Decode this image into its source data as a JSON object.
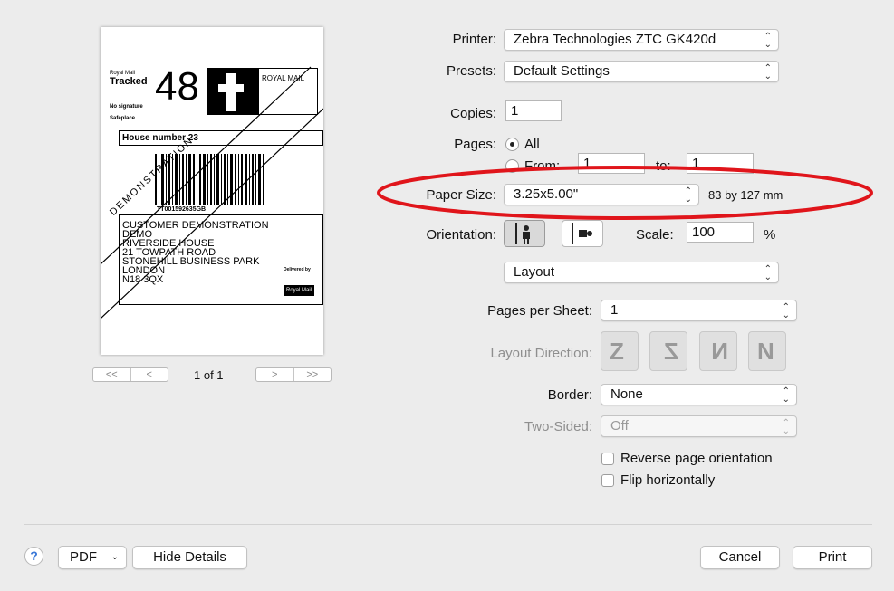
{
  "printer": {
    "label": "Printer:",
    "value": "Zebra Technologies ZTC GK420d"
  },
  "presets": {
    "label": "Presets:",
    "value": "Default Settings"
  },
  "copies": {
    "label": "Copies:",
    "value": "1"
  },
  "pages": {
    "label": "Pages:",
    "all_label": "All",
    "from_label": "From:",
    "from_value": "1",
    "to_label": "to:",
    "to_value": "1"
  },
  "paper_size": {
    "label": "Paper Size:",
    "value": "3.25x5.00\"",
    "dimensions": "83 by 127 mm"
  },
  "orientation": {
    "label": "Orientation:",
    "selected": "portrait"
  },
  "scale": {
    "label": "Scale:",
    "value": "100",
    "unit": "%"
  },
  "section": {
    "value": "Layout"
  },
  "layout": {
    "pages_per_sheet_label": "Pages per Sheet:",
    "pages_per_sheet_value": "1",
    "direction_label": "Layout Direction:",
    "border_label": "Border:",
    "border_value": "None",
    "two_sided_label": "Two-Sided:",
    "two_sided_value": "Off",
    "reverse_label": "Reverse page orientation",
    "flip_label": "Flip horizontally"
  },
  "preview": {
    "page_indicator": "1 of 1",
    "first": "<<",
    "prev": "<",
    "next": ">",
    "last": ">>",
    "label": {
      "service_line1": "Royal Mail",
      "service_line2": "Tracked",
      "number": "48",
      "brand": "ROYAL MAIL",
      "no_signature": "No signature",
      "safeplace": "Safeplace",
      "safeplace_value": "House number 23",
      "barcode_text": "TT001592635GB",
      "demo_stamp": "DEMONSTRATION",
      "address": [
        "CUSTOMER DEMONSTRATION",
        "DEMO",
        "RIVERSIDE HOUSE",
        "21 TOWPATH ROAD",
        "STONEHILL BUSINESS PARK",
        "LONDON",
        "N18 3QX"
      ],
      "delivered_by": "Delivered by",
      "logo_text": "Royal Mail"
    }
  },
  "footer": {
    "help": "?",
    "pdf": "PDF",
    "hide_details": "Hide Details",
    "cancel": "Cancel",
    "print": "Print"
  },
  "colors": {
    "highlight": "#e0151b",
    "accent": "#3a78d8"
  }
}
